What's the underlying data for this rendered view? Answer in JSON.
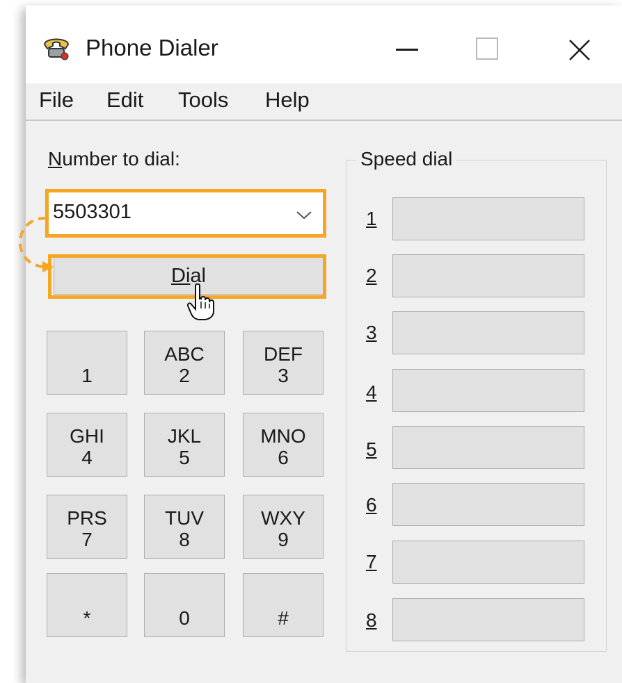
{
  "window": {
    "title": "Phone Dialer"
  },
  "menu": [
    "File",
    "Edit",
    "Tools",
    "Help"
  ],
  "number_to_dial": {
    "label_mnemonic": "N",
    "label_rest": "umber to dial:",
    "value": "5503301"
  },
  "dial_button": {
    "mnemonic": "Di",
    "rest": "al"
  },
  "keypad": [
    {
      "letters": "",
      "digit": "1"
    },
    {
      "letters": "ABC",
      "digit": "2"
    },
    {
      "letters": "DEF",
      "digit": "3"
    },
    {
      "letters": "GHI",
      "digit": "4"
    },
    {
      "letters": "JKL",
      "digit": "5"
    },
    {
      "letters": "MNO",
      "digit": "6"
    },
    {
      "letters": "PRS",
      "digit": "7"
    },
    {
      "letters": "TUV",
      "digit": "8"
    },
    {
      "letters": "WXY",
      "digit": "9"
    },
    {
      "letters": "",
      "digit": "*"
    },
    {
      "letters": "",
      "digit": "0"
    },
    {
      "letters": "",
      "digit": "#"
    }
  ],
  "speed_dial": {
    "title": "Speed dial",
    "entries": [
      "1",
      "2",
      "3",
      "4",
      "5",
      "6",
      "7",
      "8"
    ]
  },
  "colors": {
    "highlight": "#f5a623",
    "window_bg": "#f0f0f0",
    "button_bg": "#e1e1e1"
  }
}
